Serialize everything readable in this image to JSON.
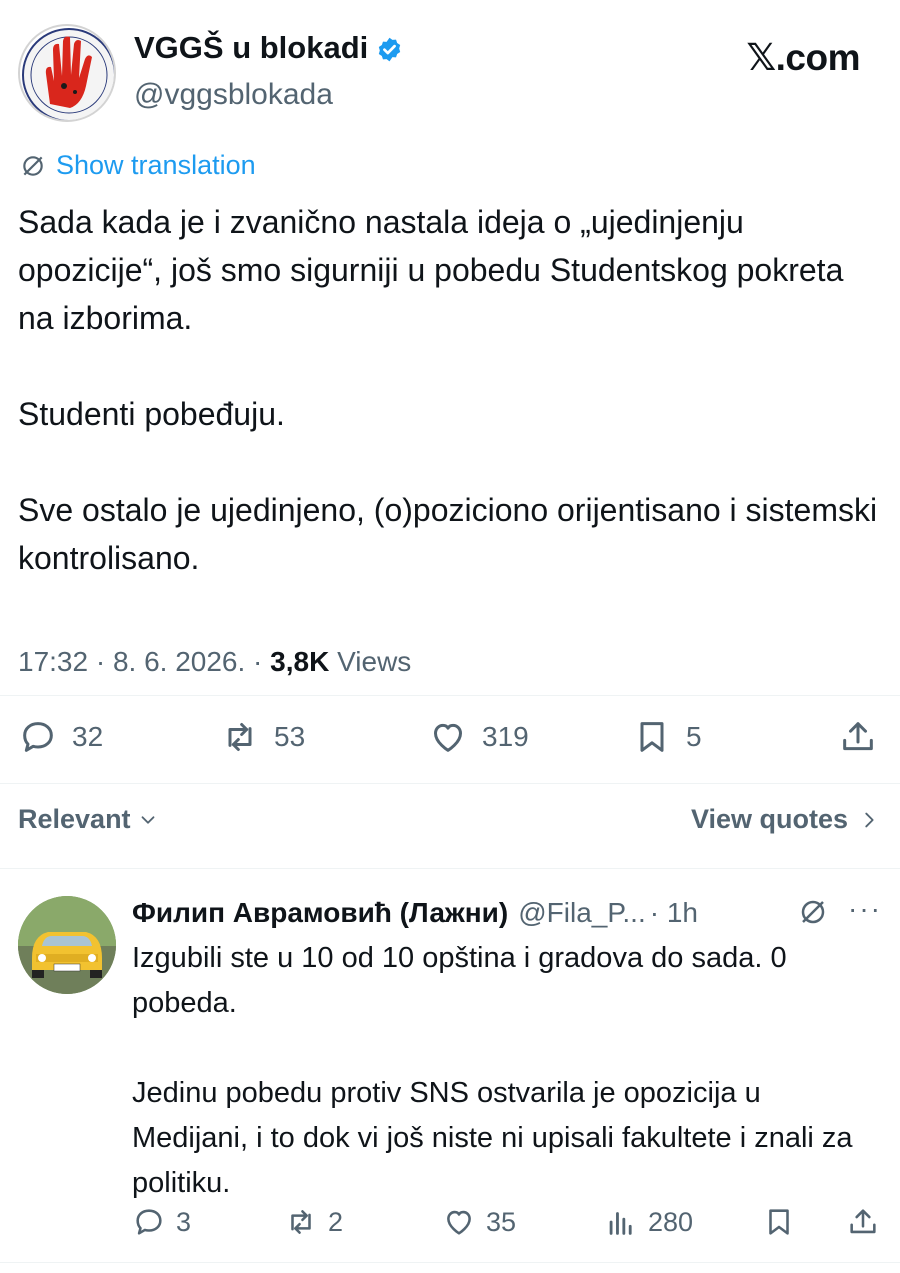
{
  "author": {
    "name": "VGGŠ u blokadi",
    "handle": "@vggsblokada"
  },
  "brand": "𝕏.com",
  "translation": {
    "label": "Show translation"
  },
  "tweet": {
    "paragraphs": [
      "Sada kada je i zvanično nastala ideja o  „ujedinjenju opozicije“, još smo sigurniji u pobedu Studentskog pokreta na izborima.",
      "Studenti pobeđuju.",
      "Sve ostalo je ujedinjeno, (o)poziciono orijentisano i sistemski kontrolisano."
    ],
    "time": "17:32 · 8. 6. 2026. · ",
    "views_count": "3,8K",
    "views_label": "Views"
  },
  "actions": {
    "replies": "32",
    "reposts": "53",
    "likes": "319",
    "bookmarks": "5"
  },
  "sort": {
    "relevant_label": "Relevant",
    "view_quotes_label": "View quotes"
  },
  "reply": {
    "name": "Филип Аврамовић (Лажни)",
    "handle": "@Fila_P...",
    "time": "· 1h",
    "more": "···",
    "paragraphs": [
      "Izgubili ste u 10 od 10 opština i gradova do sada. 0 pobeda.",
      "Jedinu pobedu protiv SNS ostvarila je opozicija u Medijani, i to dok vi još niste ni upisali fakultete i znali za politiku."
    ],
    "actions": {
      "replies": "3",
      "reposts": "2",
      "likes": "35",
      "views": "280"
    }
  },
  "colors": {
    "accent": "#1d9bf0",
    "text_primary": "#0f1419",
    "text_secondary": "#536471",
    "divider": "#eff3f4"
  }
}
